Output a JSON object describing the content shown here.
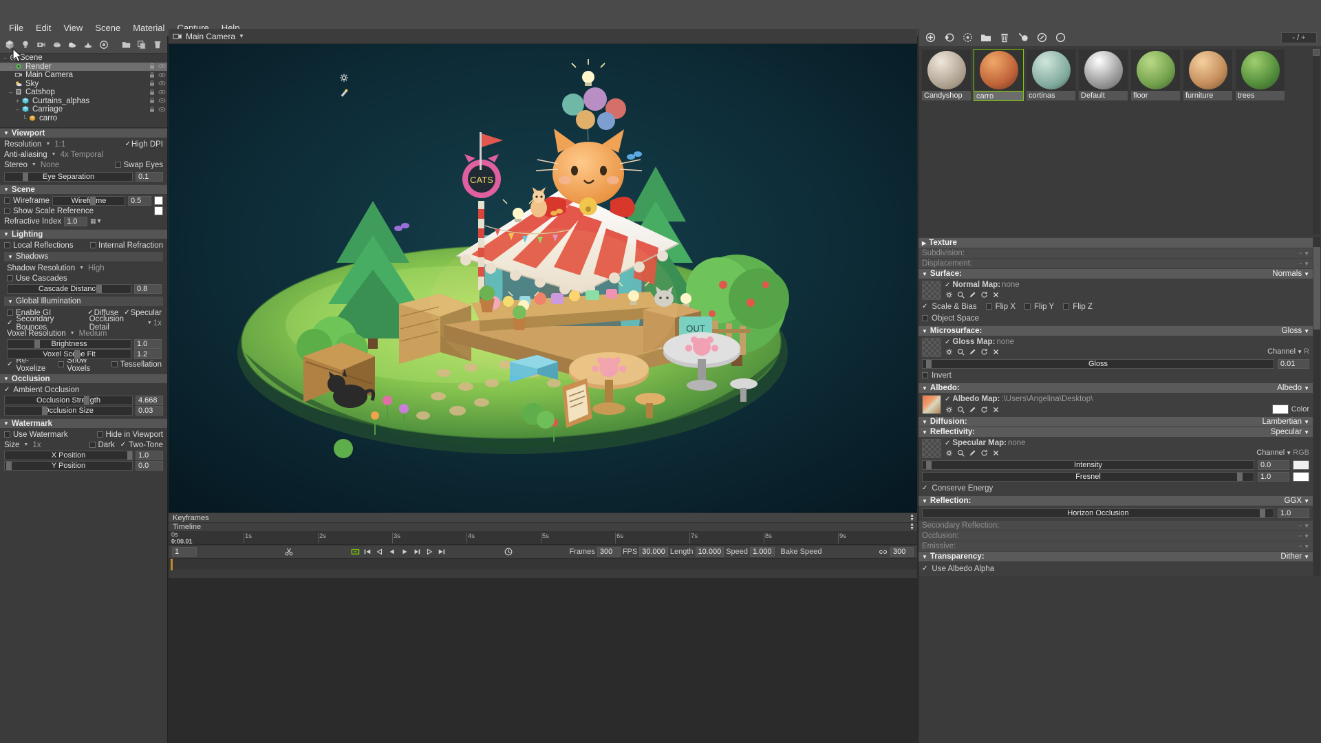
{
  "menubar": {
    "items": [
      "File",
      "Edit",
      "View",
      "Scene",
      "Material",
      "Capture",
      "Help"
    ]
  },
  "toolstrip": {
    "buttons": [
      {
        "name": "mesh-icon",
        "tip": "Mesh"
      },
      {
        "name": "light-icon",
        "tip": "Light"
      },
      {
        "name": "camera-icon",
        "tip": "Camera"
      },
      {
        "name": "fog-icon",
        "tip": "Fog"
      },
      {
        "name": "sky-icon",
        "tip": "Sky"
      },
      {
        "name": "turntable-icon",
        "tip": "Turntable"
      },
      {
        "name": "target-icon",
        "tip": "Target"
      },
      {
        "name": "folder-icon",
        "tip": "Folder"
      },
      {
        "name": "duplicate-icon",
        "tip": "Duplicate"
      },
      {
        "name": "delete-icon",
        "tip": "Delete"
      }
    ]
  },
  "outliner": {
    "nodes": [
      {
        "label": "Scene",
        "indent": 0,
        "icon": "scene-icon",
        "selected": false,
        "twisty": "-"
      },
      {
        "label": "Render",
        "indent": 1,
        "icon": "render-icon",
        "selected": true,
        "twisty": ""
      },
      {
        "label": "Main Camera",
        "indent": 1,
        "icon": "camera-icon",
        "selected": false,
        "twisty": ""
      },
      {
        "label": "Sky",
        "indent": 1,
        "icon": "sky-icon",
        "selected": false,
        "twisty": ""
      },
      {
        "label": "Catshop",
        "indent": 1,
        "icon": "file-icon",
        "selected": false,
        "twisty": "-"
      },
      {
        "label": "Curtains_alphas",
        "indent": 2,
        "icon": "mesh-icon",
        "selected": false,
        "twisty": "+"
      },
      {
        "label": "Carriage",
        "indent": 2,
        "icon": "mesh-icon",
        "selected": false,
        "twisty": "-"
      },
      {
        "label": "carro",
        "indent": 3,
        "icon": "submesh-icon",
        "selected": false,
        "twisty": ""
      }
    ]
  },
  "viewport_panel": {
    "title": "Viewport",
    "resolution_label": "Resolution",
    "resolution_value": "1:1",
    "high_dpi_label": "High DPI",
    "high_dpi_checked": true,
    "aa_label": "Anti-aliasing",
    "aa_value": "4x Temporal",
    "stereo_label": "Stereo",
    "stereo_value": "None",
    "swap_eyes_label": "Swap Eyes",
    "swap_eyes_checked": false,
    "eye_separation_label": "Eye Separation",
    "eye_separation_value": "0.1",
    "eye_separation_pct": 14
  },
  "scene_panel": {
    "title": "Scene",
    "wireframe_label": "Wireframe",
    "wireframe_checked": false,
    "wireframe_slider_label": "Wireframe",
    "wireframe_value": "0.5",
    "wireframe_pct": 52,
    "show_scale_reference_label": "Show Scale Reference",
    "show_scale_reference_checked": false,
    "refractive_index_label": "Refractive Index",
    "refractive_index_value": "1.0"
  },
  "lighting_panel": {
    "title": "Lighting",
    "local_reflections_label": "Local Reflections",
    "local_reflections_checked": false,
    "internal_refraction_label": "Internal Refraction",
    "internal_refraction_checked": false,
    "shadows": {
      "title": "Shadows",
      "shadow_resolution_label": "Shadow Resolution",
      "shadow_resolution_value": "High",
      "use_cascades_label": "Use Cascades",
      "use_cascades_checked": false,
      "cascade_distance_label": "Cascade Distance",
      "cascade_distance_value": "0.8",
      "cascade_distance_pct": 72
    },
    "gi": {
      "title": "Global Illumination",
      "enable_gi_label": "Enable GI",
      "enable_gi_checked": false,
      "diffuse_label": "Diffuse",
      "diffuse_checked": true,
      "specular_label": "Specular",
      "specular_checked": true,
      "secondary_bounces_label": "Secondary Bounces",
      "secondary_bounces_checked": true,
      "occlusion_detail_label": "Occlusion Detail",
      "occlusion_detail_value": "1x",
      "voxel_resolution_label": "Voxel Resolution",
      "voxel_resolution_value": "Medium",
      "brightness_label": "Brightness",
      "brightness_value": "1.0",
      "brightness_pct": 22,
      "voxel_scene_fit_label": "Voxel Scene Fit",
      "voxel_scene_fit_value": "1.2",
      "voxel_scene_fit_pct": 54,
      "revoxelize_label": "Re-Voxelize",
      "revoxelize_checked": true,
      "show_voxels_label": "Show Voxels",
      "show_voxels_checked": false,
      "tessellation_label": "Tessellation",
      "tessellation_checked": false
    }
  },
  "occlusion_panel": {
    "title": "Occlusion",
    "ambient_occlusion_label": "Ambient Occlusion",
    "ambient_occlusion_checked": true,
    "occlusion_strength_label": "Occlusion Strength",
    "occlusion_strength_value": "4.668",
    "occlusion_strength_pct": 62,
    "occlusion_size_label": "Occlusion Size",
    "occlusion_size_value": "0.03",
    "occlusion_size_pct": 29
  },
  "watermark_panel": {
    "title": "Watermark",
    "use_watermark_label": "Use Watermark",
    "use_watermark_checked": false,
    "hide_in_viewport_label": "Hide in Viewport",
    "hide_in_viewport_checked": false,
    "size_label": "Size",
    "size_value": "1x",
    "dark_label": "Dark",
    "dark_checked": false,
    "two_tone_label": "Two-Tone",
    "two_tone_checked": true,
    "x_position_label": "X Position",
    "x_position_value": "1.0",
    "x_position_pct": 96,
    "y_position_label": "Y Position",
    "y_position_value": "0.0",
    "y_position_pct": 3
  },
  "viewport": {
    "camera_name": "Main Camera",
    "settings_icon": "gear-icon",
    "light_icon": "light-tool-icon"
  },
  "timeline": {
    "keyframes_label": "Keyframes",
    "timeline_label": "Timeline",
    "playhead_time_top": "0s",
    "playhead_time_bottom": "0:00.01",
    "current_frame": "1",
    "ticks": [
      "1s",
      "2s",
      "3s",
      "4s",
      "5s",
      "6s",
      "7s",
      "8s",
      "9s"
    ],
    "controls": {
      "frames_label": "Frames",
      "frames_value": "300",
      "fps_label": "FPS",
      "fps_value": "30.000",
      "length_label": "Length",
      "length_value": "10.000",
      "speed_label": "Speed",
      "speed_value": "1.000",
      "bake_speed_label": "Bake Speed",
      "link_value": "300"
    }
  },
  "materials": {
    "toolbar_icons": [
      "add-material-icon",
      "duplicate-material-icon",
      "clear-material-icon",
      "folder-icon",
      "delete-icon",
      "assign-icon",
      "pick-icon",
      "eyedropper-icon"
    ],
    "count_display": "- /",
    "count_plus": "+",
    "items": [
      {
        "name": "Candyshop",
        "active": false,
        "c1": "#d9d0c2",
        "c2": "#8e8272"
      },
      {
        "name": "carro",
        "active": true,
        "c1": "#d8804a",
        "c2": "#7a4326"
      },
      {
        "name": "cortinas",
        "active": false,
        "c1": "#b9cfc4",
        "c2": "#5d7a72"
      },
      {
        "name": "Default",
        "active": false,
        "c1": "#f2f2f2",
        "c2": "#6b6b6b"
      },
      {
        "name": "floor",
        "active": false,
        "c1": "#9fc276",
        "c2": "#4e6b36"
      },
      {
        "name": "furniture",
        "active": false,
        "c1": "#e6b98a",
        "c2": "#9a6c43"
      },
      {
        "name": "trees",
        "active": false,
        "c1": "#7fae5a",
        "c2": "#3f5c2d"
      }
    ]
  },
  "material_props": {
    "texture": {
      "label": "Texture",
      "collapsed": true
    },
    "subdivision": {
      "label": "Subdivision:",
      "value": "-",
      "dim": true
    },
    "displacement": {
      "label": "Displacement:",
      "value": "-",
      "dim": true
    },
    "surface": {
      "label": "Surface:",
      "value": "Normals",
      "map_label": "Normal Map:",
      "map_value": "none",
      "map_checked": true,
      "scale_bias_label": "Scale & Bias",
      "scale_bias_checked": true,
      "flip_x_label": "Flip X",
      "flip_x_checked": false,
      "flip_y_label": "Flip Y",
      "flip_y_checked": false,
      "flip_z_label": "Flip Z",
      "flip_z_checked": false,
      "object_space_label": "Object Space",
      "object_space_checked": false
    },
    "microsurface": {
      "label": "Microsurface:",
      "value": "Gloss",
      "map_label": "Gloss Map:",
      "map_value": "none",
      "map_checked": true,
      "channel_label": "Channel",
      "channel_value": "R",
      "gloss_label": "Gloss",
      "gloss_value": "0.01",
      "gloss_pct": 2,
      "invert_label": "Invert",
      "invert_checked": false
    },
    "albedo": {
      "label": "Albedo:",
      "value": "Albedo",
      "map_label": "Albedo Map:",
      "map_value": ":\\Users\\Angelina\\Desktop\\",
      "map_checked": true,
      "color_label": "Color",
      "color_hex": "#ffffff"
    },
    "diffusion": {
      "label": "Diffusion:",
      "value": "Lambertian"
    },
    "reflectivity": {
      "label": "Reflectivity:",
      "value": "Specular",
      "map_label": "Specular Map:",
      "map_value": "none",
      "map_checked": true,
      "channel_label": "Channel",
      "channel_value": "RGB",
      "intensity_label": "Intensity",
      "intensity_value": "0.0",
      "intensity_pct": 2,
      "intensity_color": "#f0f0f0",
      "fresnel_label": "Fresnel",
      "fresnel_value": "1.0",
      "fresnel_pct": 95,
      "fresnel_color": "#ffffff",
      "conserve_energy_label": "Conserve Energy",
      "conserve_energy_checked": true
    },
    "reflection": {
      "label": "Reflection:",
      "value": "GGX",
      "horizon_occlusion_label": "Horizon Occlusion",
      "horizon_occlusion_value": "1.0",
      "horizon_occlusion_pct": 96
    },
    "secondary_reflection": {
      "label": "Secondary Reflection:",
      "value": "-",
      "dim": true
    },
    "occlusion": {
      "label": "Occlusion:",
      "value": "-",
      "dim": true
    },
    "emissive": {
      "label": "Emissive:",
      "value": "-",
      "dim": true
    },
    "transparency": {
      "label": "Transparency:",
      "value": "Dither",
      "use_albedo_alpha_label": "Use Albedo Alpha",
      "use_albedo_alpha_checked": true
    }
  },
  "colors": {
    "accent_green": "#7fd400",
    "panel_bg": "#3b3b3b",
    "header_bg": "#555555",
    "viewport_bg": "#0b2630"
  }
}
